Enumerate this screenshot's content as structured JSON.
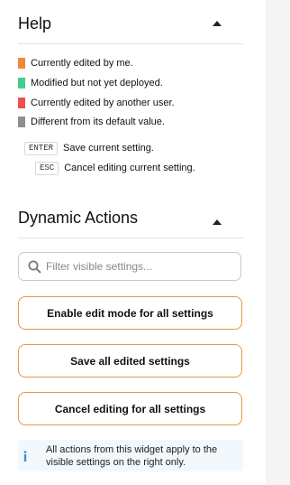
{
  "help": {
    "title": "Help",
    "legend": [
      {
        "color": "#f0883b",
        "label": "Currently edited by me."
      },
      {
        "color": "#3ecf8e",
        "label": "Modified but not yet deployed."
      },
      {
        "color": "#ef4f4f",
        "label": "Currently edited by another user."
      },
      {
        "color": "#8f8f8f",
        "label": "Different from its default value."
      }
    ],
    "shortcuts": [
      {
        "key": "ENTER",
        "label": "Save current setting."
      },
      {
        "key": "ESC",
        "label": "Cancel editing current setting."
      }
    ]
  },
  "actions": {
    "title": "Dynamic Actions",
    "search_placeholder": "Filter visible settings...",
    "buttons": [
      "Enable edit mode for all settings",
      "Save all edited settings",
      "Cancel editing for all settings"
    ],
    "info_text": "All actions from this widget apply to the visible settings on the right only."
  },
  "colors": {
    "button_border": "#e8954b",
    "info_background": "#f3f8fd",
    "info_icon": "#3a8fd6"
  }
}
